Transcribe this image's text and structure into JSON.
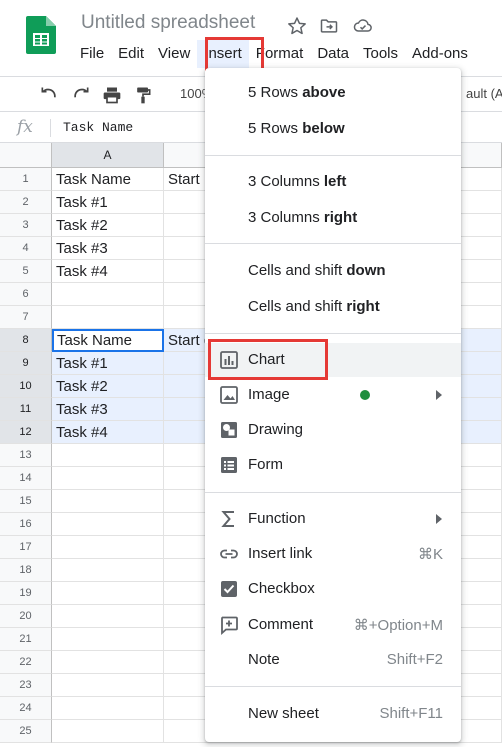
{
  "doc": {
    "title": "Untitled spreadsheet"
  },
  "menubar": [
    "File",
    "Edit",
    "View",
    "Insert",
    "Format",
    "Data",
    "Tools",
    "Add-ons"
  ],
  "toolbar": {
    "zoom": "100%",
    "font": "ault (Ar"
  },
  "formula": {
    "fx": "fx",
    "value": "Task Name"
  },
  "columns": [
    "A"
  ],
  "rows": [
    {
      "n": "1",
      "a": "Task Name",
      "b": "Start D"
    },
    {
      "n": "2",
      "a": "Task #1",
      "b": ""
    },
    {
      "n": "3",
      "a": "Task #2",
      "b": ""
    },
    {
      "n": "4",
      "a": "Task #3",
      "b": ""
    },
    {
      "n": "5",
      "a": "Task #4",
      "b": ""
    },
    {
      "n": "6",
      "a": "",
      "b": ""
    },
    {
      "n": "7",
      "a": "",
      "b": ""
    },
    {
      "n": "8",
      "a": "Task Name",
      "b": "Start d"
    },
    {
      "n": "9",
      "a": "Task #1",
      "b": ""
    },
    {
      "n": "10",
      "a": "Task #2",
      "b": ""
    },
    {
      "n": "11",
      "a": "Task #3",
      "b": ""
    },
    {
      "n": "12",
      "a": "Task #4",
      "b": ""
    },
    {
      "n": "13",
      "a": "",
      "b": ""
    },
    {
      "n": "14",
      "a": "",
      "b": ""
    },
    {
      "n": "15",
      "a": "",
      "b": ""
    },
    {
      "n": "16",
      "a": "",
      "b": ""
    },
    {
      "n": "17",
      "a": "",
      "b": ""
    },
    {
      "n": "18",
      "a": "",
      "b": ""
    },
    {
      "n": "19",
      "a": "",
      "b": ""
    },
    {
      "n": "20",
      "a": "",
      "b": ""
    },
    {
      "n": "21",
      "a": "",
      "b": ""
    },
    {
      "n": "22",
      "a": "",
      "b": ""
    },
    {
      "n": "23",
      "a": "",
      "b": ""
    },
    {
      "n": "24",
      "a": "",
      "b": ""
    },
    {
      "n": "25",
      "a": "",
      "b": ""
    }
  ],
  "insert_menu": {
    "rows_above": {
      "pre": "5 Rows ",
      "bold": "above"
    },
    "rows_below": {
      "pre": "5 Rows ",
      "bold": "below"
    },
    "cols_left": {
      "pre": "3 Columns ",
      "bold": "left"
    },
    "cols_right": {
      "pre": "3 Columns ",
      "bold": "right"
    },
    "shift_down": {
      "pre": "Cells and shift ",
      "bold": "down"
    },
    "shift_right": {
      "pre": "Cells and shift ",
      "bold": "right"
    },
    "chart": "Chart",
    "image": "Image",
    "drawing": "Drawing",
    "form": "Form",
    "function": "Function",
    "insert_link": "Insert link",
    "insert_link_shortcut": "⌘K",
    "checkbox": "Checkbox",
    "comment": "Comment",
    "comment_shortcut": "⌘+Option+M",
    "note": "Note",
    "note_shortcut": "Shift+F2",
    "new_sheet": "New sheet",
    "new_sheet_shortcut": "Shift+F11"
  },
  "colors": {
    "accent": "#1a73e8",
    "highlight_box": "#e53935",
    "sheets_green": "#0f9d58",
    "new_dot": "#1e8e3e"
  }
}
